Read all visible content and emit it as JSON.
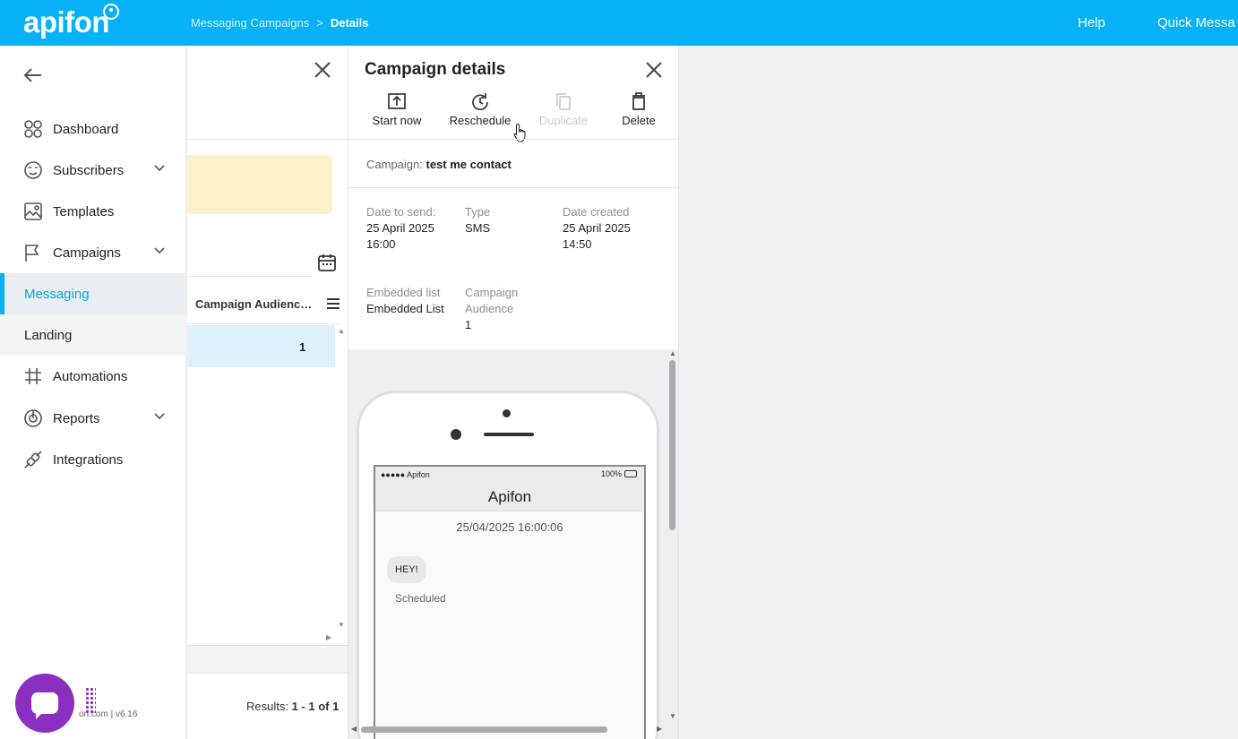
{
  "topbar": {
    "logo": "apifon",
    "breadcrumb": [
      "Messaging Campaigns",
      ">",
      "Details"
    ],
    "help": "Help",
    "quick": "Quick Messa"
  },
  "sidebar": {
    "items": [
      {
        "label": "Dashboard",
        "icon": "dashboard-icon"
      },
      {
        "label": "Subscribers",
        "icon": "subscribers-icon"
      },
      {
        "label": "Templates",
        "icon": "templates-icon"
      },
      {
        "label": "Campaigns",
        "icon": "flag-icon"
      },
      {
        "label": "Messaging"
      },
      {
        "label": "Landing"
      },
      {
        "label": "Automations",
        "icon": "automations-icon"
      },
      {
        "label": "Reports",
        "icon": "reports-icon"
      },
      {
        "label": "Integrations",
        "icon": "integrations-icon"
      }
    ],
    "version": "on.com | v6.16"
  },
  "list": {
    "column_header": "Campaign Audienc…",
    "row_value": "1",
    "results_label": "Results:",
    "results_value": "1 - 1 of 1"
  },
  "details": {
    "title": "Campaign details",
    "actions": {
      "start": "Start now",
      "reschedule": "Reschedule",
      "duplicate": "Duplicate",
      "delete": "Delete"
    },
    "campaign_label": "Campaign:",
    "campaign_name": "test me contact",
    "date_to_send_label": "Date to send:",
    "date_to_send_value": "25 April 2025 16:00",
    "type_label": "Type",
    "type_value": "SMS",
    "date_created_label": "Date created",
    "date_created_value": "25 April 2025 14:50",
    "embedded_label": "Embedded list",
    "embedded_value": "Embedded List",
    "audience_label": "Campaign Audience",
    "audience_value": "1"
  },
  "phone": {
    "signal": "●●●●● Apifon",
    "battery": "100%",
    "sender": "Apifon",
    "timestamp": "25/04/2025 16:00:06",
    "message": "HEY!",
    "status": "Scheduled"
  },
  "colors": {
    "brand": "#06b2f5",
    "chat": "#8a2fbf"
  }
}
